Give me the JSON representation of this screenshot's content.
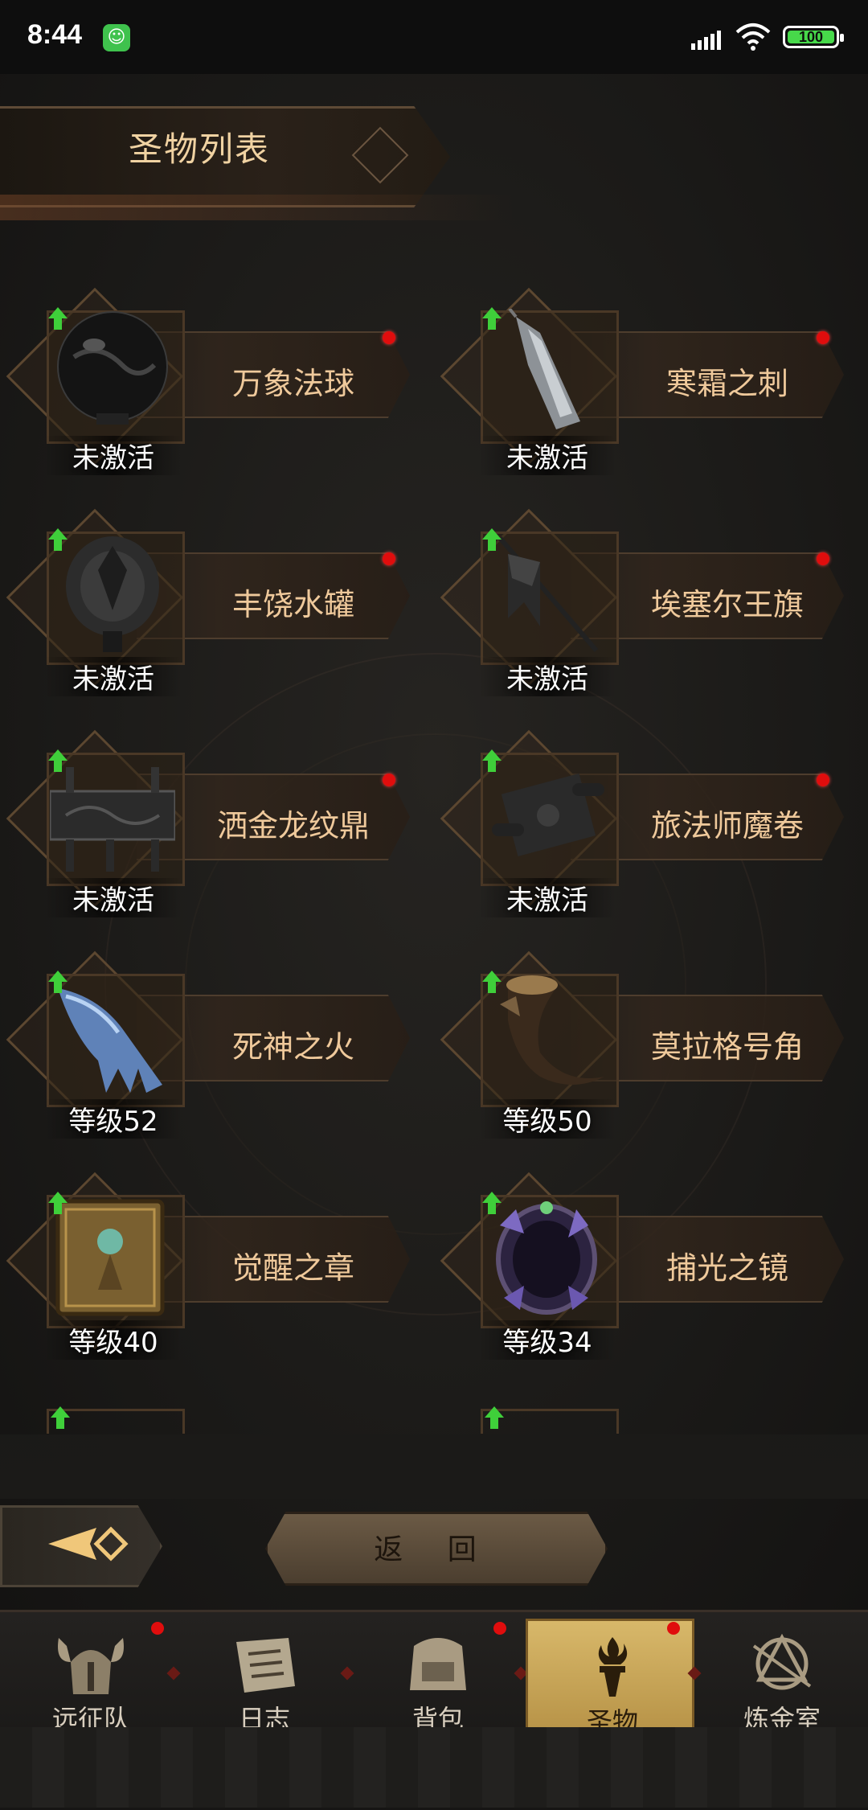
{
  "status_bar": {
    "time": "8:44",
    "battery": "100"
  },
  "page_title": "圣物列表",
  "relics": [
    {
      "name": "万象法球",
      "status": "未激活",
      "has_dot": true
    },
    {
      "name": "寒霜之刺",
      "status": "未激活",
      "has_dot": true
    },
    {
      "name": "丰饶水罐",
      "status": "未激活",
      "has_dot": true
    },
    {
      "name": "埃塞尔王旗",
      "status": "未激活",
      "has_dot": true
    },
    {
      "name": "洒金龙纹鼎",
      "status": "未激活",
      "has_dot": true
    },
    {
      "name": "旅法师魔卷",
      "status": "未激活",
      "has_dot": true
    },
    {
      "name": "死神之火",
      "status": "等级52",
      "has_dot": false
    },
    {
      "name": "莫拉格号角",
      "status": "等级50",
      "has_dot": false
    },
    {
      "name": "觉醒之章",
      "status": "等级40",
      "has_dot": false
    },
    {
      "name": "捕光之镜",
      "status": "等级34",
      "has_dot": false
    }
  ],
  "back_button": "返 回",
  "tabs": [
    {
      "label": "远征队",
      "icon": "helmet-icon",
      "has_dot": true
    },
    {
      "label": "日志",
      "icon": "scroll-icon",
      "has_dot": false
    },
    {
      "label": "背包",
      "icon": "bag-icon",
      "has_dot": true
    },
    {
      "label": "圣物",
      "icon": "torch-icon",
      "has_dot": true,
      "active": true
    },
    {
      "label": "炼金室",
      "icon": "alchemy-icon",
      "has_dot": false
    }
  ],
  "colors": {
    "accent": "#d8b86a",
    "text_gold": "#efc99b",
    "notify_red": "#e00d0d",
    "upgrade_green": "#3fcf3a"
  }
}
